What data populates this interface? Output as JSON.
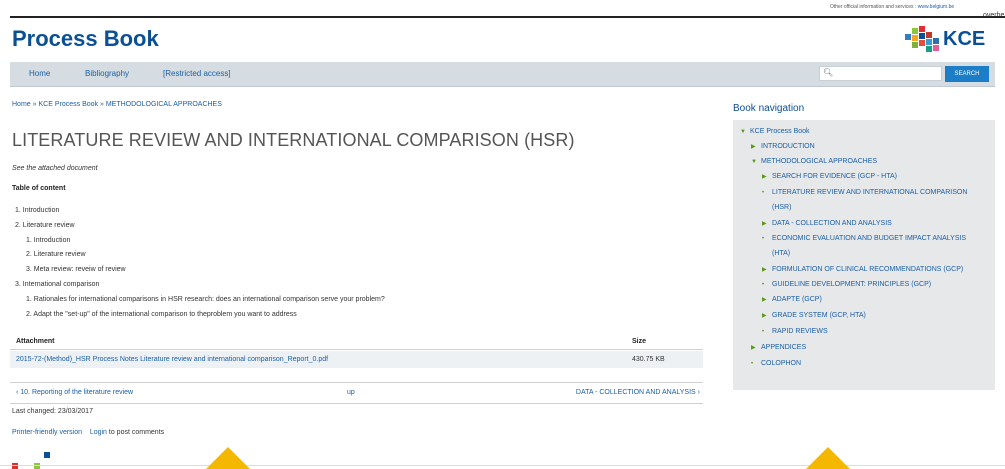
{
  "header": {
    "official_text": "Other official information and services :",
    "official_link": "www.belgium.be",
    "overflow_text": "overhe",
    "brand": "Process Book",
    "logo_text": "KCE"
  },
  "nav": {
    "items": [
      {
        "label": "Home"
      },
      {
        "label": "Bibliography"
      },
      {
        "label": "[Restricted access]"
      }
    ],
    "search_button": "SEARCH",
    "search_placeholder": ""
  },
  "breadcrumb": {
    "home": "Home",
    "sep": "»",
    "book": "KCE Process Book",
    "section": "METHODOLOGICAL APPROACHES"
  },
  "page": {
    "title": "LITERATURE REVIEW AND INTERNATIONAL COMPARISON (HSR)",
    "intro": "See the attached document",
    "toc_heading": "Table of content",
    "toc": [
      "1. Introduction",
      "2. Literature review",
      "1. Introduction",
      "2. Literature review",
      "3. Meta review: reveiw of review",
      "3. International comparison",
      "1. Rationales for international comparisons in HSR research: does an international comparison serve your problem?",
      "2. Adapt the \"set-up\" of the international comparison to theproblem you want to address"
    ]
  },
  "attachments": {
    "col_attachment": "Attachment",
    "col_size": "Size",
    "rows": [
      {
        "name": "2015-72-(Method)_HSR Process Notes Literature review and international comparison_Report_0.pdf",
        "size": "430.75 KB"
      }
    ]
  },
  "pager": {
    "prev": "‹ 10. Reporting of the literature review",
    "up": "up",
    "next": "DATA - COLLECTION AND ANALYSIS ›"
  },
  "footer": {
    "last_changed": "Last changed: 23/03/2017",
    "printer": "Printer-friendly version",
    "login": "Login",
    "login_suffix": " to post comments"
  },
  "sidebar": {
    "title": "Book navigation",
    "items": [
      {
        "marker": "▼",
        "label": "KCE Process Book"
      },
      {
        "marker": "▶",
        "label": "INTRODUCTION"
      },
      {
        "marker": "▼",
        "label": "METHODOLOGICAL APPROACHES"
      },
      {
        "marker": "▶",
        "label": "SEARCH FOR EVIDENCE (GCP - HTA)"
      },
      {
        "marker": "•",
        "label": "LITERATURE REVIEW AND INTERNATIONAL COMPARISON",
        "label2": "(HSR)"
      },
      {
        "marker": "▶",
        "label": "DATA - COLLECTION AND ANALYSIS"
      },
      {
        "marker": "•",
        "label": "ECONOMIC EVALUATION AND BUDGET IMPACT ANALYSIS",
        "label2": "(HTA)"
      },
      {
        "marker": "▶",
        "label": "FORMULATION OF CLINICAL RECOMMENDATIONS (GCP)"
      },
      {
        "marker": "•",
        "label": "GUIDELINE DEVELOPMENT: PRINCIPLES (GCP)"
      },
      {
        "marker": "▶",
        "label": "ADAPTE (GCP)"
      },
      {
        "marker": "▶",
        "label": "GRADE SYSTEM (GCP, HTA)"
      },
      {
        "marker": "•",
        "label": "RAPID REVIEWS"
      },
      {
        "marker": "▶",
        "label": "APPENDICES"
      },
      {
        "marker": "•",
        "label": "COLOPHON"
      }
    ]
  },
  "colors": {
    "brand_blue": "#0b4f96",
    "link_blue": "#1a5fa8",
    "nav_bg": "#d5dde2",
    "button_blue": "#1c7ec6",
    "marker_green": "#5a9a17",
    "accent_yellow": "#f5b800"
  }
}
